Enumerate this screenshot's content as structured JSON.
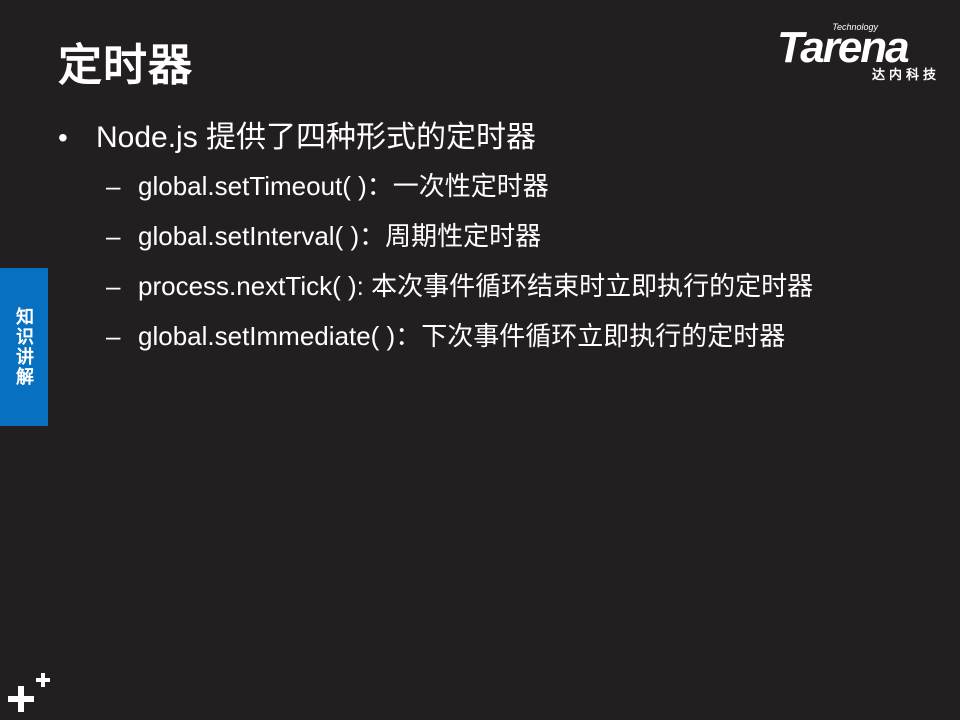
{
  "slide": {
    "title": "定时器",
    "logo": {
      "brand": "Tarena",
      "tagline": "Technology",
      "chinese": "达内科技"
    },
    "side_tab": "知识讲解",
    "bullets": [
      {
        "level": 1,
        "marker": "•",
        "text": "Node.js 提供了四种形式的定时器"
      },
      {
        "level": 2,
        "marker": "–",
        "text": "global.setTimeout( )：一次性定时器"
      },
      {
        "level": 2,
        "marker": "–",
        "text": "global.setInterval( )：周期性定时器"
      },
      {
        "level": 2,
        "marker": "–",
        "text": "process.nextTick( ): 本次事件循环结束时立即执行的定时器"
      },
      {
        "level": 2,
        "marker": "–",
        "text": "global.setImmediate( )：下次事件循环立即执行的定时器"
      }
    ]
  },
  "colors": {
    "background": "#231f20",
    "text": "#ffffff",
    "side_tab": "#0870c0"
  },
  "icons": {
    "corner_mark": "plus-plus-icon"
  }
}
